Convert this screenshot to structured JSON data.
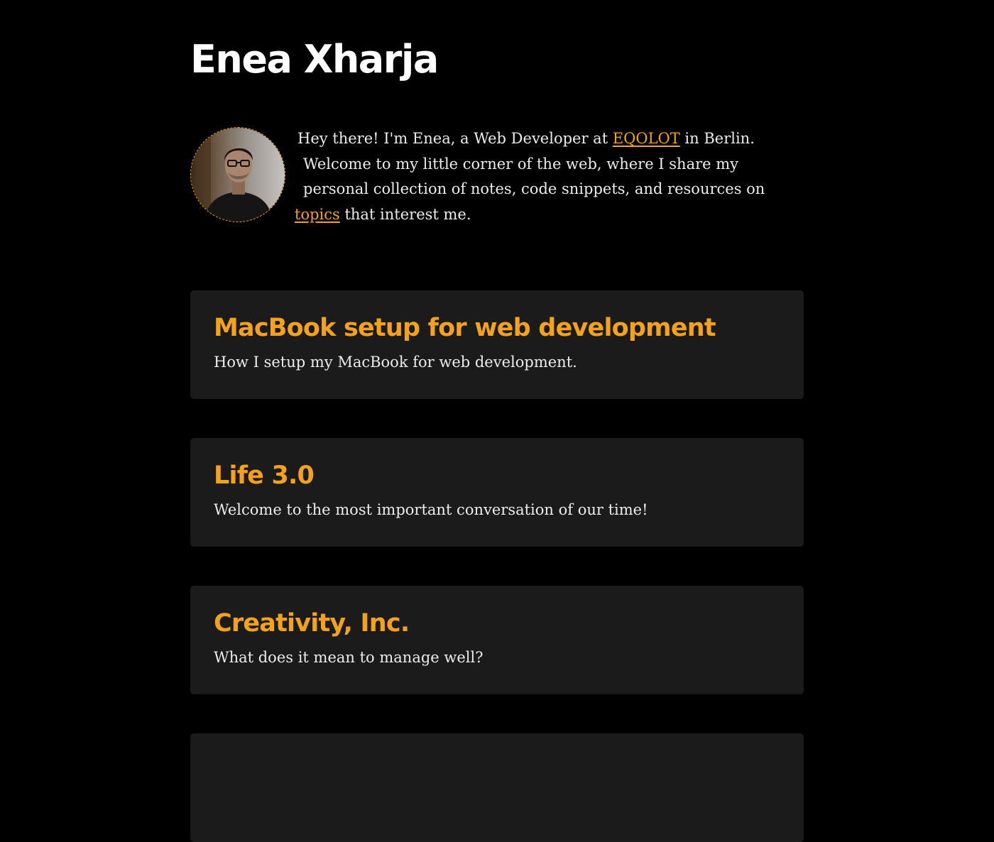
{
  "header": {
    "site_title": "Enea Xharja"
  },
  "intro": {
    "avatar_alt": "Portrait of Enea",
    "line1_before": "Hey there! I'm Enea, a Web Developer at ",
    "company_link": "EQOLOT",
    "line1_after": " in Berlin.",
    "line2": "Welcome to my little corner of the web, where I share my",
    "line3": "personal collection of notes, code snippets, and resources on",
    "topics_link": "topics",
    "line4_after": " that interest me."
  },
  "posts": [
    {
      "title": "MacBook setup for web development",
      "description": "How I setup my MacBook for web development."
    },
    {
      "title": "Life 3.0",
      "description": "Welcome to the most important conversation of our time!"
    },
    {
      "title": "Creativity, Inc.",
      "description": "What does it mean to manage well?"
    },
    {
      "title": "",
      "description": ""
    }
  ],
  "colors": {
    "background": "#000000",
    "card": "#1b1b1b",
    "accent": "#f4a21c",
    "text": "#ececec",
    "title": "#ffffff"
  }
}
